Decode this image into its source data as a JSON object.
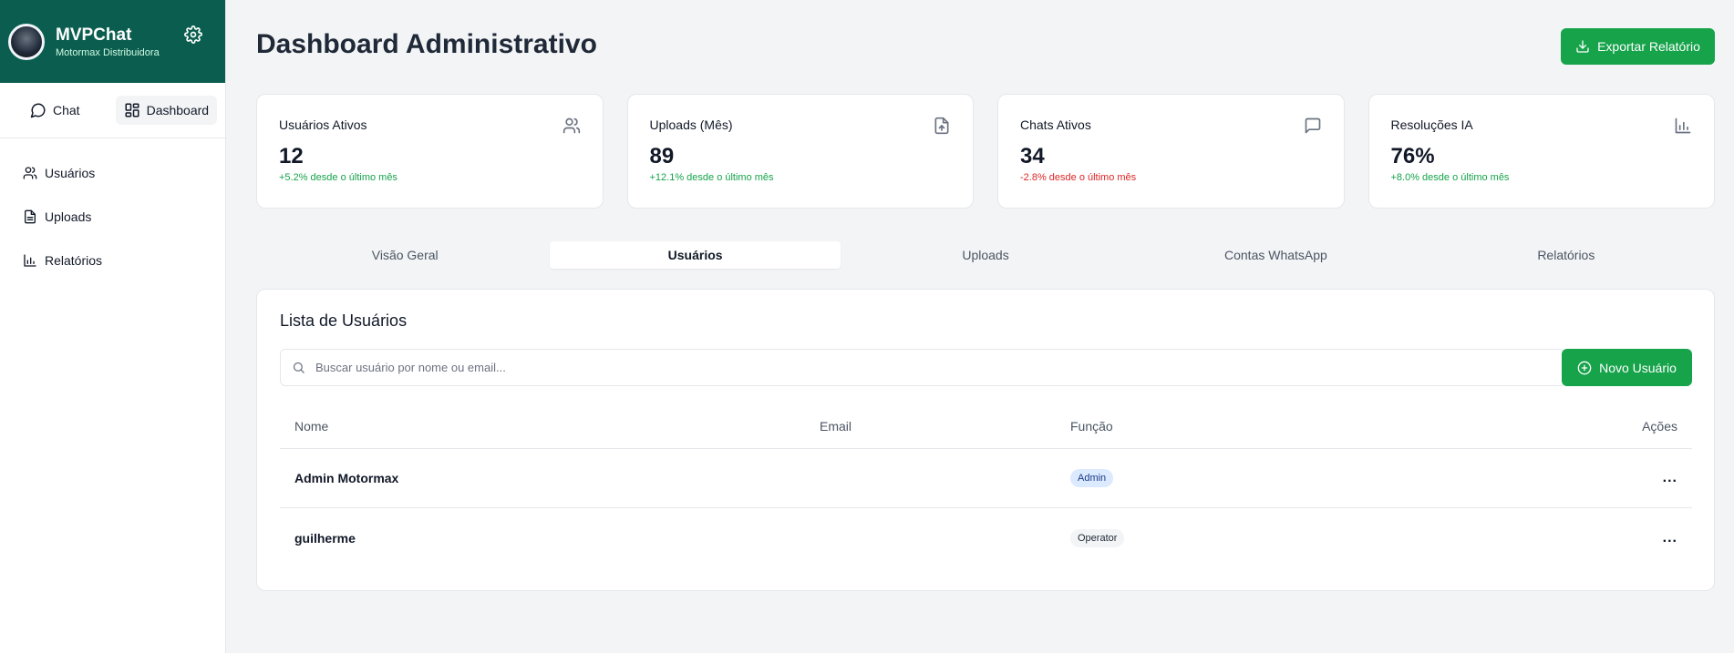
{
  "sidebar": {
    "brand": {
      "title": "MVPChat",
      "subtitle": "Motormax Distribuidora"
    },
    "modes": [
      {
        "label": "Chat"
      },
      {
        "label": "Dashboard"
      }
    ],
    "nav": [
      {
        "label": "Usuários"
      },
      {
        "label": "Uploads"
      },
      {
        "label": "Relatórios"
      }
    ]
  },
  "header": {
    "title": "Dashboard Administrativo",
    "export_label": "Exportar Relatório"
  },
  "stats": [
    {
      "title": "Usuários Ativos",
      "value": "12",
      "change": "+5.2% desde o último mês",
      "icon": "users-icon"
    },
    {
      "title": "Uploads (Mês)",
      "value": "89",
      "change": "+12.1% desde o último mês",
      "icon": "file-upload-icon"
    },
    {
      "title": "Chats Ativos",
      "value": "34",
      "change": "-2.8% desde o último mês",
      "icon": "message-square-icon"
    },
    {
      "title": "Resoluções IA",
      "value": "76%",
      "change": "+8.0% desde o último mês",
      "icon": "bar-chart-icon"
    }
  ],
  "tabs": [
    {
      "label": "Visão Geral"
    },
    {
      "label": "Usuários"
    },
    {
      "label": "Uploads"
    },
    {
      "label": "Contas WhatsApp"
    },
    {
      "label": "Relatórios"
    }
  ],
  "active_tab": "Usuários",
  "users_panel": {
    "title": "Lista de Usuários",
    "search_placeholder": "Buscar usuário por nome ou email...",
    "new_user_label": "Novo Usuário",
    "columns": {
      "name": "Nome",
      "email": "Email",
      "role": "Função",
      "actions": "Ações"
    },
    "rows": [
      {
        "name": "Admin Motormax",
        "email": "",
        "role": "Admin",
        "actions": "..."
      },
      {
        "name": "guilherme",
        "email": "",
        "role": "Operator",
        "actions": "..."
      }
    ]
  },
  "colors": {
    "brand_green": "#0b5e4f",
    "accent_green": "#16a34a",
    "positive": "#16a34a",
    "negative": "#dc2626"
  }
}
